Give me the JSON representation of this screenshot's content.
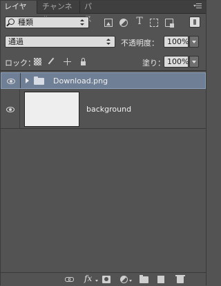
{
  "tabs": [
    {
      "label": "レイヤー",
      "active": true
    },
    {
      "label": "チャンネル",
      "active": false
    },
    {
      "label": "パス",
      "active": false
    }
  ],
  "filter": {
    "kind_label": "種類",
    "icons": [
      "image-filter-icon",
      "adjustment-filter-icon",
      "type-filter-icon",
      "shape-filter-icon",
      "smart-object-filter-icon"
    ]
  },
  "blend": {
    "mode": "通過",
    "opacity_label": "不透明度：",
    "opacity_value": "100%"
  },
  "lock": {
    "label": "ロック：",
    "fill_label": "塗り：",
    "fill_value": "100%"
  },
  "layers": [
    {
      "name": "Download.png",
      "type": "group",
      "selected": true,
      "visible": true
    },
    {
      "name": "background",
      "type": "pixel",
      "selected": false,
      "visible": true,
      "thumb_color": "#eeeeee"
    }
  ],
  "colors": {
    "panel_bg": "#535353",
    "selected_layer": "#6f7f95"
  }
}
